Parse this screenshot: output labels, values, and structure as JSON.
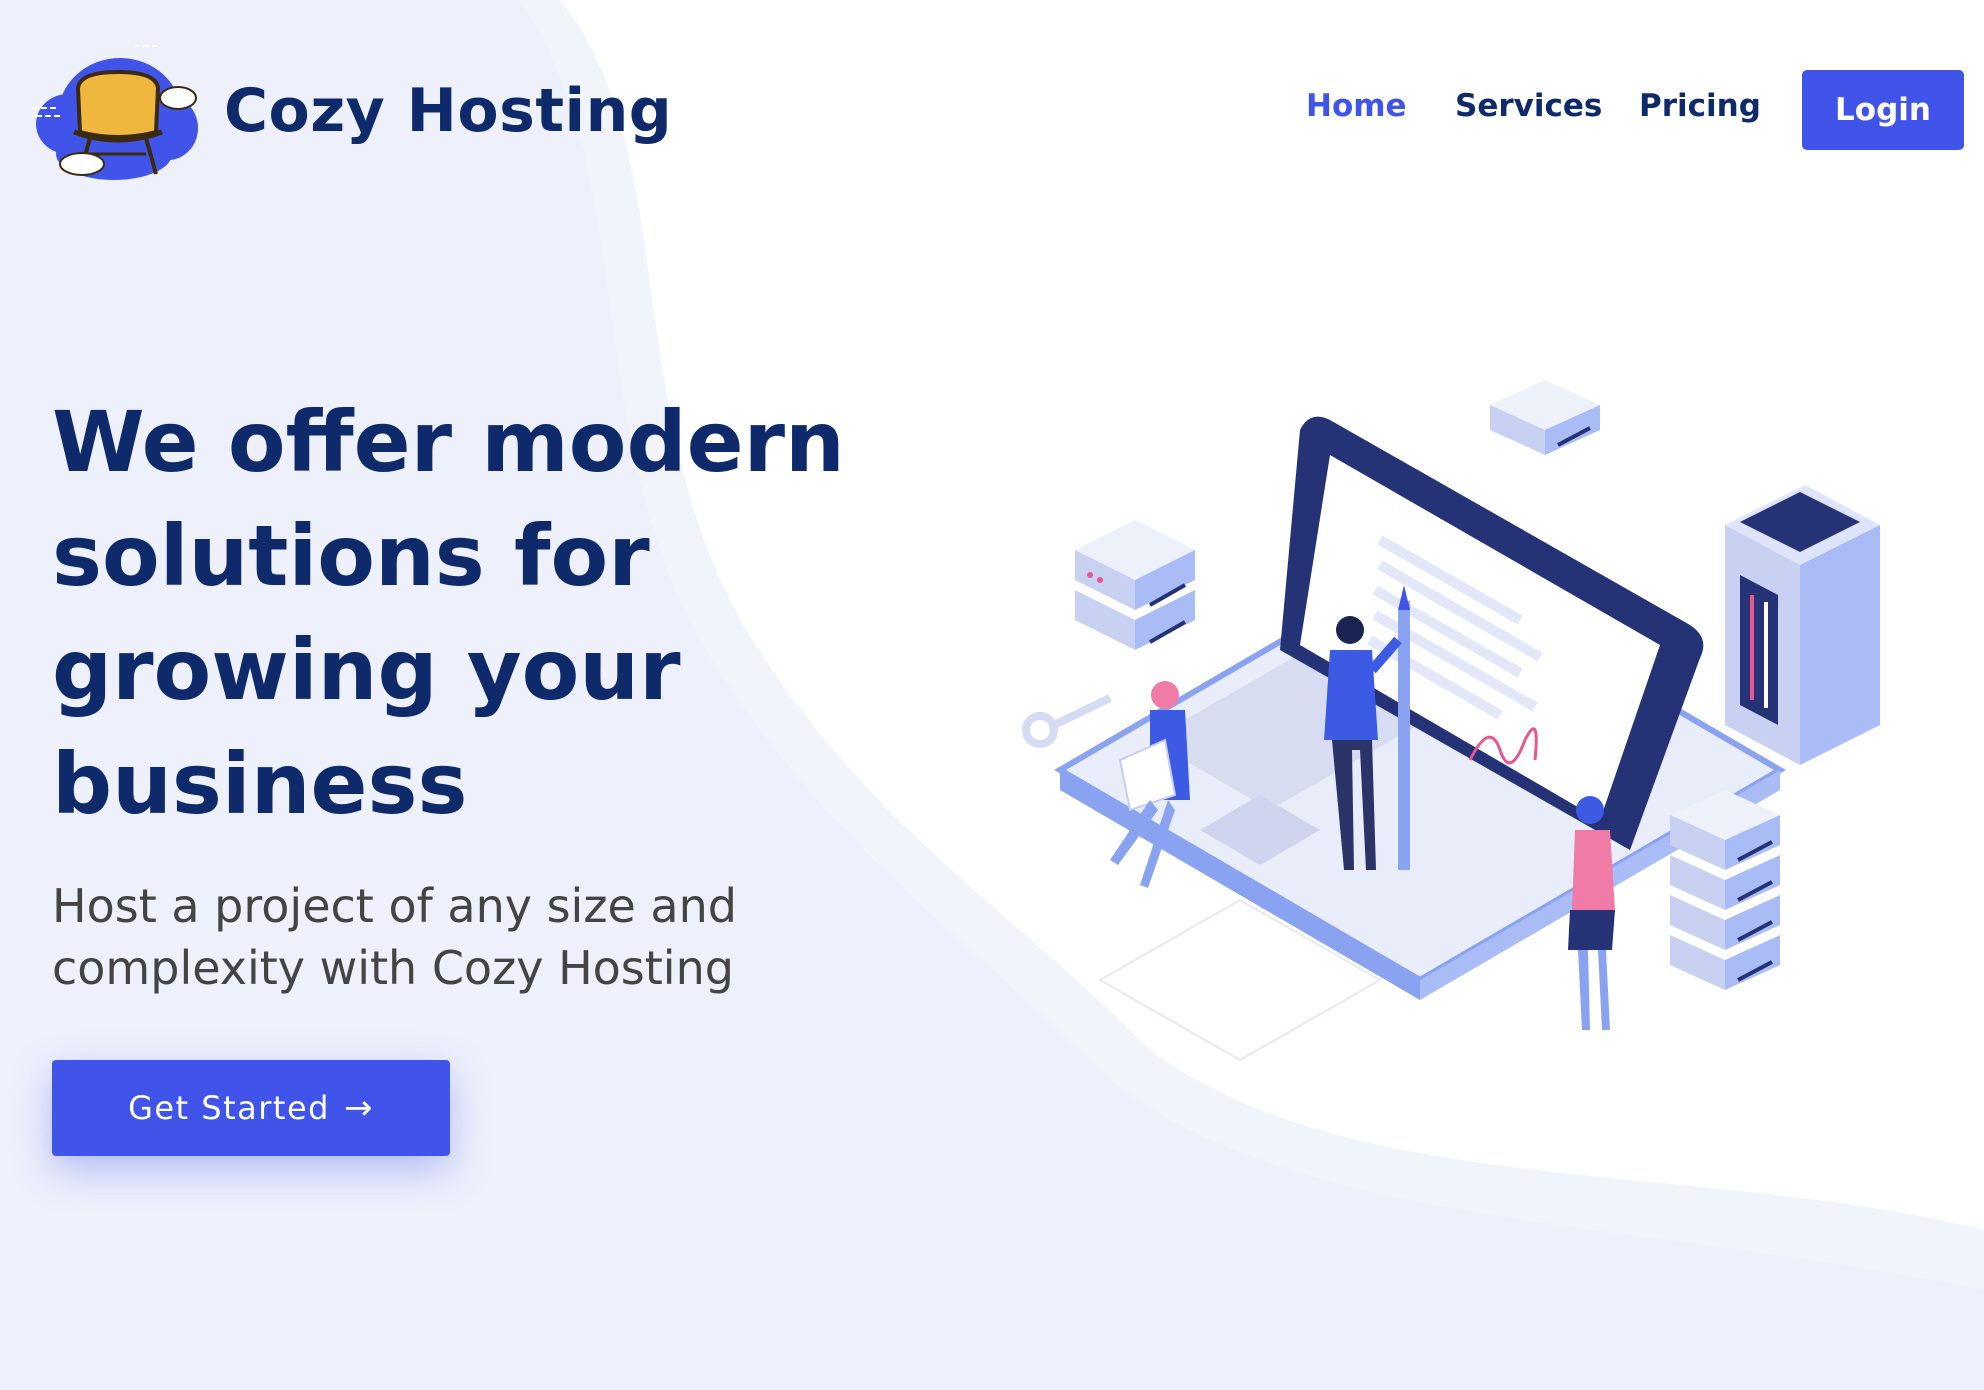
{
  "brand": {
    "name": "Cozy Hosting",
    "logo_icon": "cloud-armchair-logo"
  },
  "nav": {
    "items": [
      {
        "label": "Home",
        "active": true
      },
      {
        "label": "Services",
        "active": false
      },
      {
        "label": "Pricing",
        "active": false
      }
    ],
    "login_label": "Login"
  },
  "hero": {
    "title": "We offer modern solutions for growing your business",
    "subtitle": "Host a project of any size and complexity with Cozy Hosting",
    "cta_label": "Get Started",
    "cta_icon": "arrow-right-icon"
  },
  "illustration": {
    "icon": "isometric-laptop-servers-illustration"
  },
  "colors": {
    "primary": "#4154ea",
    "heading": "#0e2a6b",
    "body_text": "#444444",
    "background_wave": "#f2f4fc"
  }
}
